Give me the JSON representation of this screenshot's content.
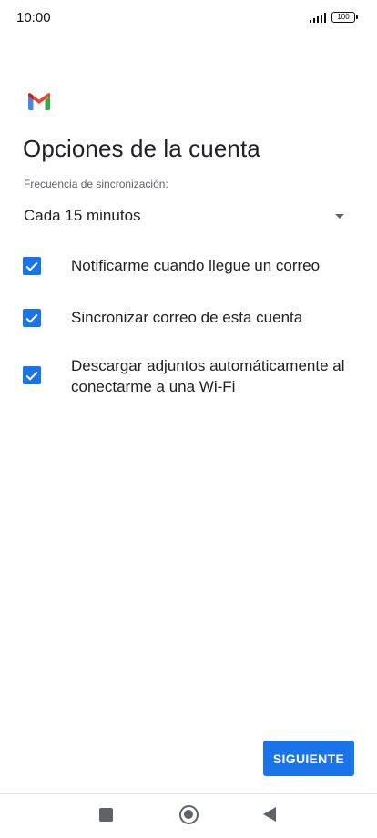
{
  "status_bar": {
    "time": "10:00",
    "battery": "100"
  },
  "app": {
    "logo_icon": "gmail-logo-icon",
    "title": "Opciones de la cuenta"
  },
  "sync": {
    "label": "Frecuencia de sincronización:",
    "selected": "Cada 15 minutos",
    "icon": "dropdown-caret-icon"
  },
  "options": [
    {
      "label": "Notificarme cuando llegue un correo",
      "checked": true
    },
    {
      "label": "Sincronizar correo de esta cuenta",
      "checked": true
    },
    {
      "label": "Descargar adjuntos automáticamente al conectarme a una Wi-Fi",
      "checked": true
    }
  ],
  "actions": {
    "next_label": "SIGUIENTE"
  },
  "colors": {
    "accent": "#1a73e8",
    "text_primary": "#202124",
    "text_secondary": "#5f6368"
  },
  "nav_bar": {
    "icons": [
      "recents-square-icon",
      "home-circle-icon",
      "back-triangle-icon"
    ]
  }
}
